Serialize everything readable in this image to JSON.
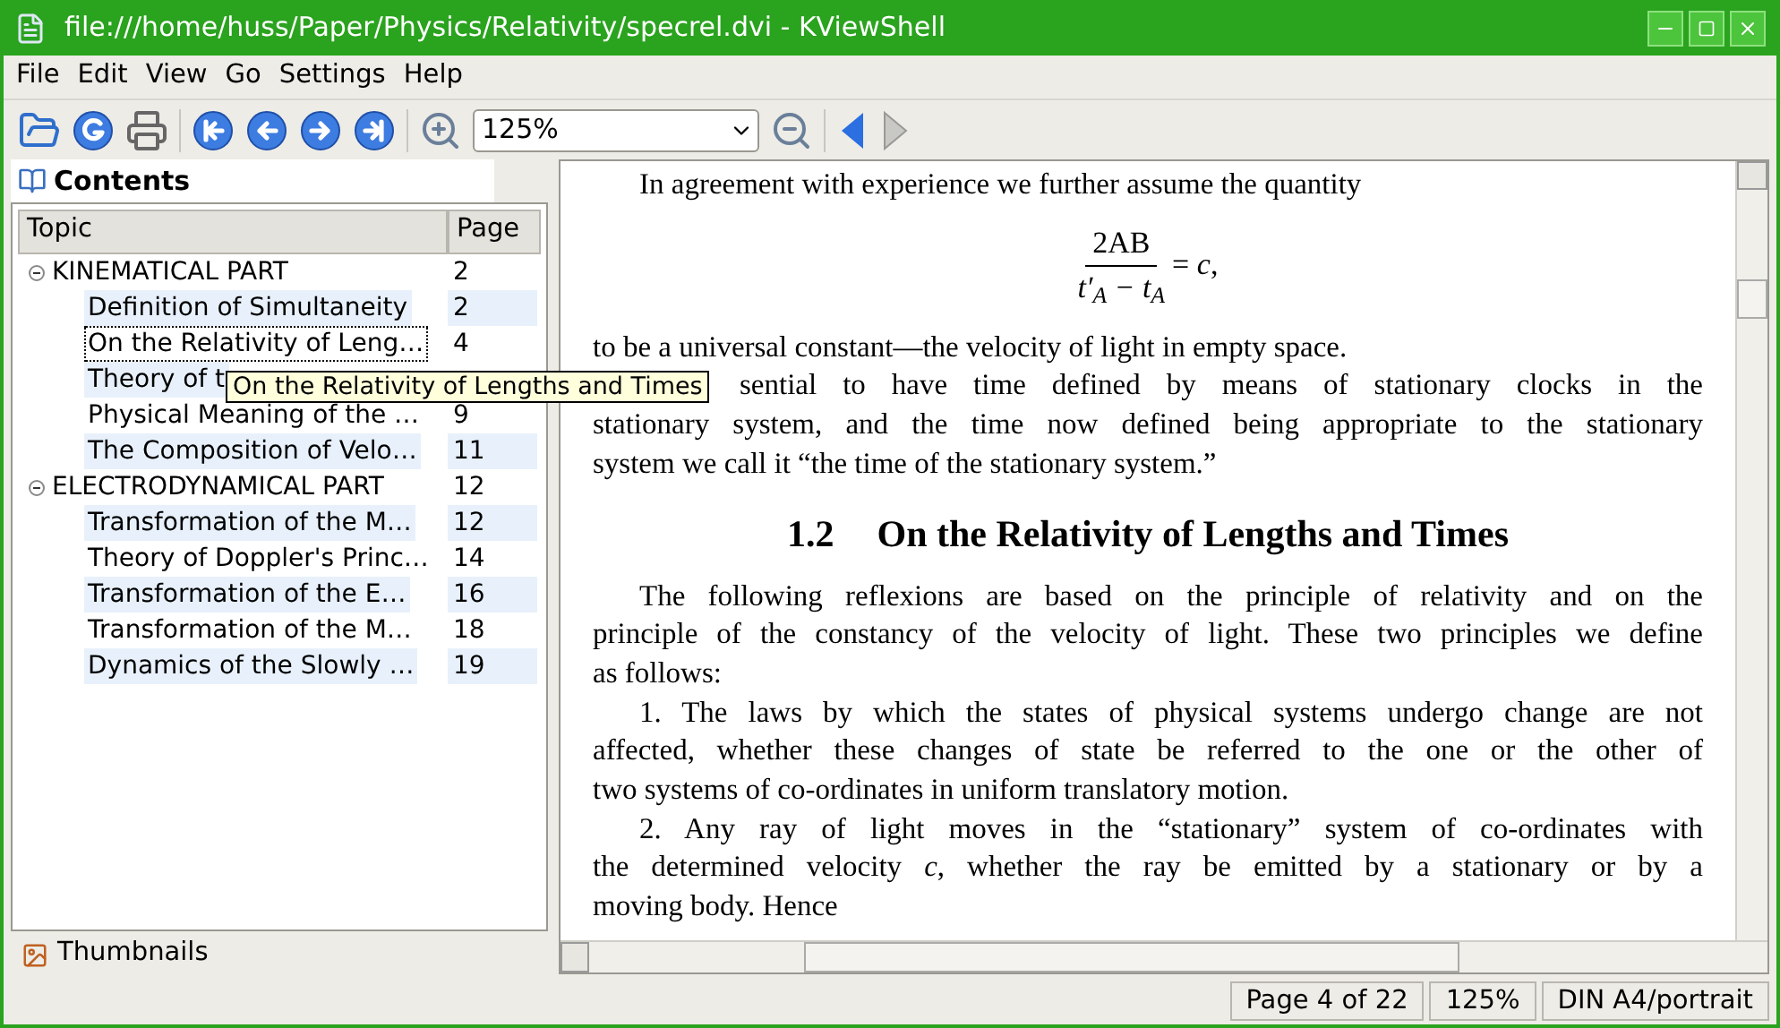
{
  "window": {
    "title": "file:///home/huss/Paper/Physics/Relativity/specrel.dvi - KViewShell"
  },
  "menu": [
    "File",
    "Edit",
    "View",
    "Go",
    "Settings",
    "Help"
  ],
  "toolbar": {
    "zoom_value": "125%"
  },
  "sidebar": {
    "tabs": [
      {
        "label": "Contents",
        "selected": true
      },
      {
        "label": "Thumbnails",
        "selected": false
      }
    ],
    "columns": [
      "Topic",
      "Page"
    ],
    "tree": [
      {
        "topic": "KINEMATICAL PART",
        "page": "2",
        "expanded": true,
        "selected": false,
        "children": [
          {
            "topic": "Definition of Simultaneity",
            "page": "2",
            "selected": false
          },
          {
            "topic": "On the Relativity of Leng…",
            "page": "4",
            "selected": true
          },
          {
            "topic": "Theory of t",
            "selected": false
          },
          {
            "topic": "Physical Meaning of the …",
            "page": "9",
            "selected": false
          },
          {
            "topic": "The Composition of Velo…",
            "page": "11",
            "selected": false
          }
        ]
      },
      {
        "topic": "ELECTRODYNAMICAL PART",
        "page": "12",
        "expanded": true,
        "selected": false,
        "children": [
          {
            "topic": "Transformation of the M…",
            "page": "12",
            "selected": false
          },
          {
            "topic": "Theory of Doppler's Princ…",
            "page": "14",
            "selected": false
          },
          {
            "topic": "Transformation of the E…",
            "page": "16",
            "selected": false
          },
          {
            "topic": "Transformation of the M…",
            "page": "18",
            "selected": false
          },
          {
            "topic": "Dynamics of the Slowly …",
            "page": "19",
            "selected": false
          }
        ]
      }
    ],
    "tooltip": "On the Relativity of Lengths and Times"
  },
  "document": [
    {
      "kind": "indented_end",
      "text": "In agreement with experience we further assume the quantity"
    },
    {
      "kind": "equation",
      "numerator": "2AB",
      "denominator": "t′$_{A}$ − t$_{A}$",
      "rhs": "= *c*,"
    },
    {
      "kind": "end",
      "text": "to be a universal constant—the velocity of light in empty space."
    },
    {
      "kind": "partial",
      "text": "sential to have time defined by means of stationary clocks in the"
    },
    {
      "kind": "line",
      "text": "stationary system, and the time now defined being appropriate to the stationary"
    },
    {
      "kind": "end",
      "text": "system we call it “the time of the stationary system.”"
    },
    {
      "kind": "heading",
      "number": "1.2",
      "text": "On the Relativity of Lengths and Times"
    },
    {
      "kind": "indented",
      "text": "The following reflexions are based on the principle of relativity and on the"
    },
    {
      "kind": "line",
      "text": "principle of the constancy of the velocity of light. These two principles we define"
    },
    {
      "kind": "end",
      "text": "as follows:"
    },
    {
      "kind": "indented",
      "text": "1. The laws by which the states of physical systems undergo change are not"
    },
    {
      "kind": "line",
      "text": "affected, whether these changes of state be referred to the one or the other of"
    },
    {
      "kind": "end",
      "text": "two systems of co-ordinates in uniform translatory motion."
    },
    {
      "kind": "indented",
      "text": "2. Any ray of light moves in the “stationary” system of co-ordinates with"
    },
    {
      "kind": "line",
      "text": "the determined velocity *c*, whether the ray be emitted by a stationary or by a"
    },
    {
      "kind": "end",
      "text": "moving body. Hence"
    }
  ],
  "status_bar": [
    "Page 4 of 22",
    "125%",
    "DIN A4/portrait"
  ]
}
